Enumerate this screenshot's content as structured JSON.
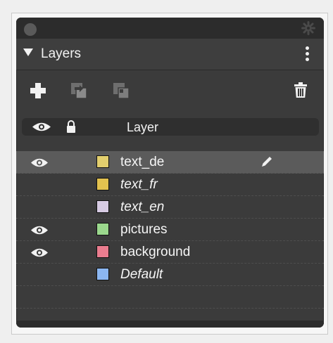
{
  "panel": {
    "title": "Layers",
    "column_header": "Layer",
    "accent": "#5b5b5b"
  },
  "toolbar": {
    "icons": [
      "add-layer-icon",
      "duplicate-layer-icon",
      "merge-layer-icon",
      "delete-layer-icon"
    ]
  },
  "layers": [
    {
      "name": "text_de",
      "color": "#e3cf6e",
      "visible": true,
      "italic": false,
      "selected": true,
      "editing": true
    },
    {
      "name": "text_fr",
      "color": "#e3c24f",
      "visible": false,
      "italic": true,
      "selected": false,
      "editing": false
    },
    {
      "name": "text_en",
      "color": "#d7cbe3",
      "visible": false,
      "italic": true,
      "selected": false,
      "editing": false
    },
    {
      "name": "pictures",
      "color": "#9bd88d",
      "visible": true,
      "italic": false,
      "selected": false,
      "editing": false
    },
    {
      "name": "background",
      "color": "#ea7d8f",
      "visible": true,
      "italic": false,
      "selected": false,
      "editing": false
    },
    {
      "name": "Default",
      "color": "#8cb7f2",
      "visible": false,
      "italic": true,
      "selected": false,
      "editing": false
    }
  ]
}
